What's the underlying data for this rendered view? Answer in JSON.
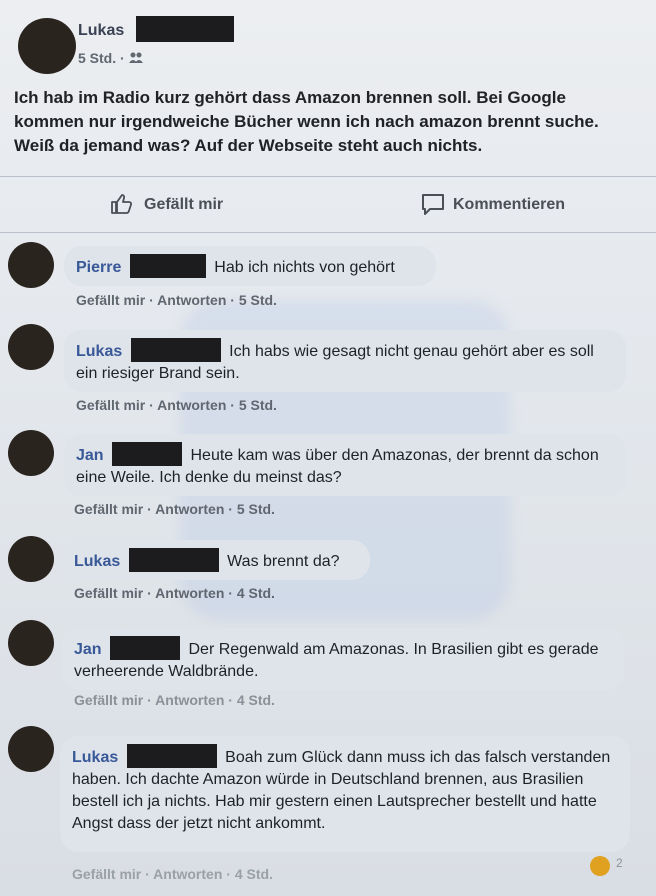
{
  "post": {
    "author": "Lukas",
    "meta": "5 Std. ·",
    "text": "Ich hab im Radio kurz gehört dass Amazon brennen soll. Bei Google kommen nur irgendweiche Bücher wenn ich nach amazon brennt suche. Weiß da jemand was? Auf der Webseite steht auch nichts."
  },
  "actions": {
    "like": "Gefällt mir",
    "comment": "Kommentieren"
  },
  "comments": [
    {
      "author": "Pierre",
      "text": "Hab ich nichts von gehört",
      "meta": "Gefällt mir · Antworten · 5 Std."
    },
    {
      "author": "Lukas",
      "text": "Ich habs wie gesagt nicht genau gehört aber es soll ein riesiger Brand sein.",
      "meta": "Gefällt mir · Antworten · 5 Std."
    },
    {
      "author": "Jan",
      "text": "Heute kam was über den Amazonas, der brennt da schon eine Weile. Ich denke du meinst das?",
      "meta": "Gefällt mir · Antworten · 5 Std."
    },
    {
      "author": "Lukas",
      "text": "Was brennt da?",
      "meta": "Gefällt mir · Antworten · 4 Std."
    },
    {
      "author": "Jan",
      "text": "Der Regenwald am Amazonas. In Brasilien gibt es gerade verheerende Waldbrände.",
      "meta": "Gefällt mir · Antworten · 4 Std."
    },
    {
      "author": "Lukas",
      "text": "Boah zum Glück dann muss ich das falsch verstanden haben. Ich dachte Amazon würde in Deutschland brennen, aus Brasilien bestell ich ja nichts. Hab mir gestern einen Lautsprecher bestellt und hatte Angst dass der jetzt nicht ankommt.",
      "meta": "Gefällt mir · Antworten · 4 Std.",
      "reactions": "2"
    }
  ],
  "colors": {
    "accent": "#385898",
    "redaction": "#1c1c1e"
  }
}
